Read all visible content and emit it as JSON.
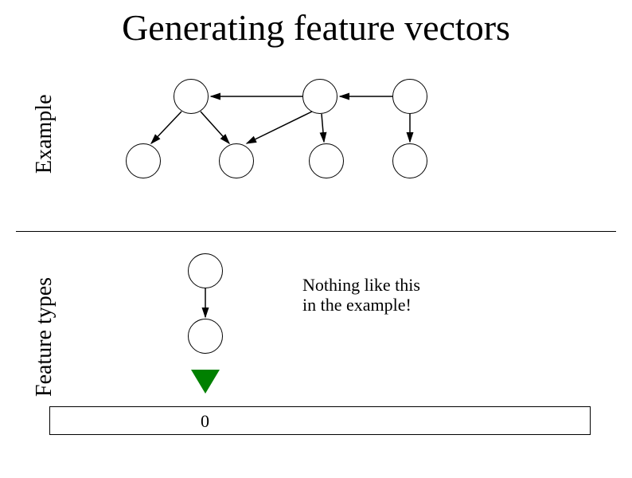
{
  "title": "Generating feature vectors",
  "labels": {
    "example": "Example",
    "feature_types": "Feature types"
  },
  "note": {
    "line1": "Nothing like this",
    "line2": "in the example!"
  },
  "vector": {
    "value0": "0"
  }
}
